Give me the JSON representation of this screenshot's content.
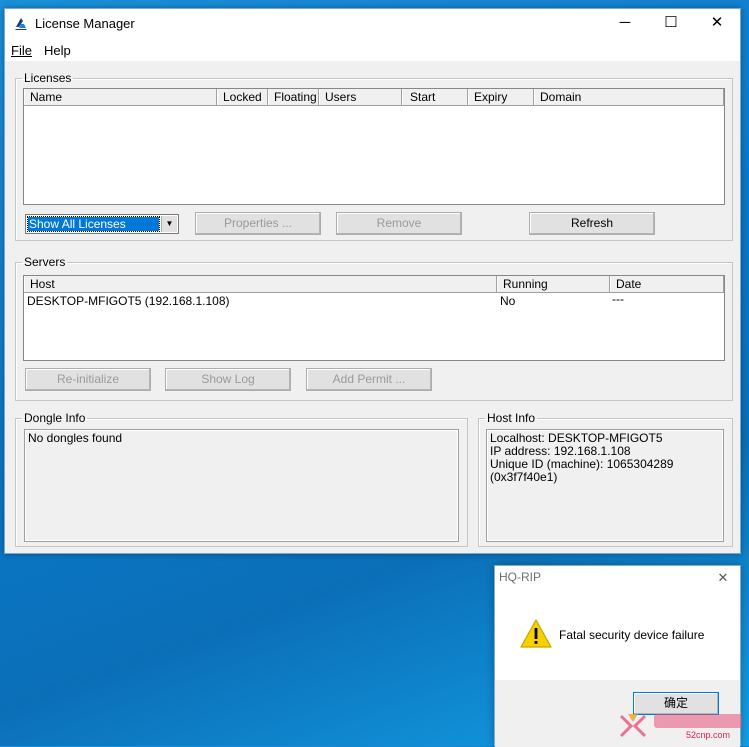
{
  "window": {
    "title": "License Manager",
    "controls": {
      "minimize": "─",
      "maximize": "☐",
      "close": "✕"
    }
  },
  "menu": [
    {
      "label": "File"
    },
    {
      "label": "Help"
    }
  ],
  "licenses": {
    "group_label": "Licenses",
    "columns": [
      "Name",
      "Locked",
      "Floating",
      "Users",
      "Start",
      "Expiry",
      "Domain"
    ],
    "filter_selected": "Show All Licenses",
    "buttons": {
      "properties": "Properties ...",
      "remove": "Remove",
      "refresh": "Refresh"
    }
  },
  "servers": {
    "group_label": "Servers",
    "columns": [
      "Host",
      "Running",
      "Date"
    ],
    "rows": [
      {
        "host": "DESKTOP-MFIGOT5  (192.168.1.108)",
        "running": "No",
        "date": "---"
      }
    ],
    "buttons": {
      "reinitialize": "Re-initialize",
      "show_log": "Show Log",
      "add_permit": "Add Permit ..."
    }
  },
  "dongle_info": {
    "group_label": "Dongle Info",
    "text": "No dongles found"
  },
  "host_info": {
    "group_label": "Host Info",
    "lines": [
      "Localhost: DESKTOP-MFIGOT5",
      "IP address: 192.168.1.108",
      "Unique ID (machine): 1065304289 (0x3f7f40e1)"
    ]
  },
  "dialog": {
    "title": "HQ-RIP",
    "message": "Fatal security device failure",
    "ok_label": "确定",
    "close": "✕"
  },
  "watermark": {
    "text": "52cnp.com"
  }
}
